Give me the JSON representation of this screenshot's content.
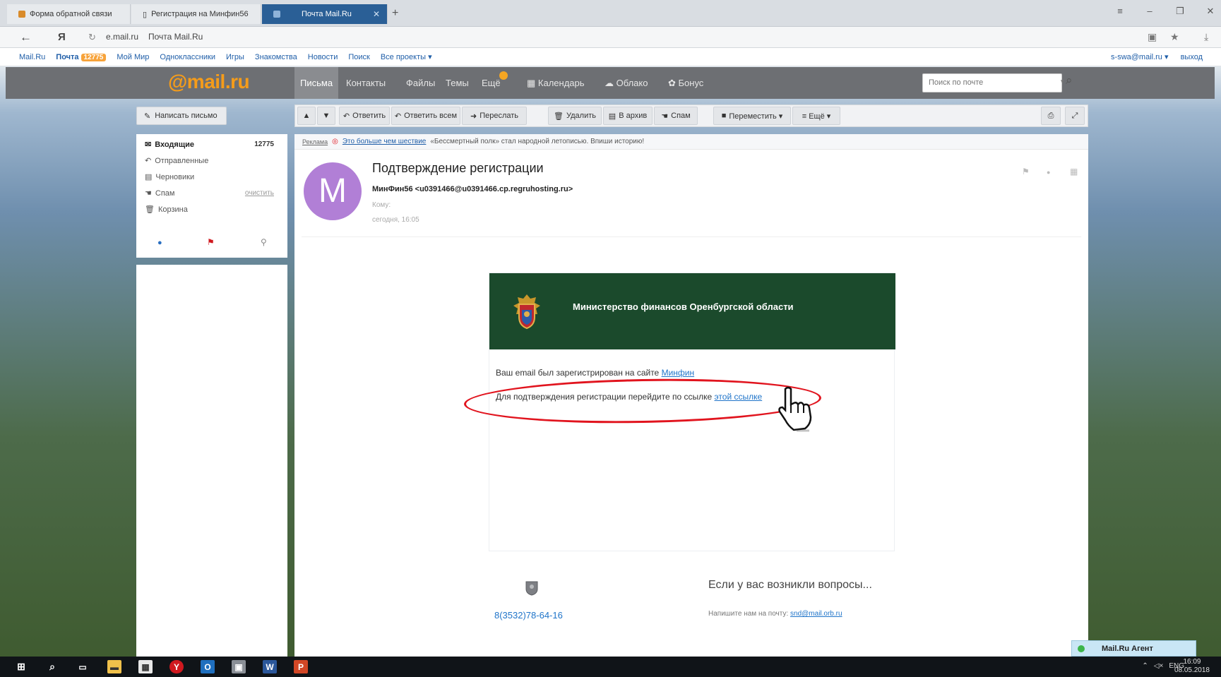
{
  "browser": {
    "tabs": [
      {
        "label": "Форма обратной связи",
        "active": false
      },
      {
        "label": "Регистрация на Минфин56",
        "active": false
      },
      {
        "label": "Почта Mail.Ru",
        "active": true
      }
    ],
    "add_tab": "+",
    "address_host": "e.mail.ru",
    "address_title": "Почта Mail.Ru",
    "window_controls": [
      "≡",
      "–",
      "❐",
      "✕"
    ]
  },
  "portal_bar": {
    "links": [
      {
        "label": "Mail.Ru"
      },
      {
        "label": "Почта",
        "badge": "12775"
      },
      {
        "label": "Мой Мир"
      },
      {
        "label": "Одноклассники"
      },
      {
        "label": "Игры"
      },
      {
        "label": "Знакомства"
      },
      {
        "label": "Новости"
      },
      {
        "label": "Поиск"
      },
      {
        "label": "Все проекты ▾"
      }
    ],
    "user": "s-swa@mail.ru ▾",
    "logout": "выход"
  },
  "header": {
    "logo_at": "@mail",
    "logo_ru": ".ru",
    "nav": [
      "Письма",
      "Контакты",
      "Файлы",
      "Темы",
      "Ещё"
    ],
    "services": [
      "Календарь",
      "Облако",
      "Бонус"
    ],
    "search_placeholder": "Поиск по почте",
    "search_dropdown": "▾"
  },
  "compose_label": "Написать письмо",
  "toolbar": {
    "reply": "Ответить",
    "reply_all": "Ответить всем",
    "forward": "Переслать",
    "delete": "Удалить",
    "archive": "В архив",
    "spam": "Спам",
    "move": "Переместить ▾",
    "more": "≡ Ещё ▾"
  },
  "folders": [
    {
      "label": "Входящие",
      "count": "12775",
      "bold": true
    },
    {
      "label": "Отправленные",
      "count": ""
    },
    {
      "label": "Черновики",
      "count": ""
    },
    {
      "label": "Спам",
      "count": "очистить"
    },
    {
      "label": "Корзина",
      "count": ""
    }
  ],
  "ad": {
    "label": "Реклама",
    "link": "Это больше чем шествие",
    "text": "«Бессмертный полк» стал народной летописью. Впиши историю!"
  },
  "message": {
    "avatar_letter": "M",
    "subject": "Подтверждение регистрации",
    "from": "МинФин56 <u0391466@u0391466.cp.regruhosting.ru>",
    "to_label": "Кому:",
    "date": "сегодня, 16:05"
  },
  "letter": {
    "ministry": "Министерство финансов Оренбургской области",
    "line1_text": "Ваш email был зарегистрирован на сайте",
    "line1_link": "Минфин",
    "line2_text": "Для подтверждения регистрации перейдите по ссылке",
    "line2_link": "этой ссылке"
  },
  "footer": {
    "phone": "8(3532)78-64-16",
    "questions": "Если у вас возникли вопросы...",
    "write_text": "Напишите нам на почту:",
    "email": "snd@mail.orb.ru"
  },
  "agent_label": "Mail.Ru Агент",
  "taskbar": {
    "lang": "ENG",
    "time": "16:09",
    "date": "08.05.2018"
  },
  "colors": {
    "accent_orange": "#f59c1a",
    "header_gray": "#6d6f73",
    "banner_green": "#1b4a2c",
    "annotation_red": "#e1141e",
    "link_blue": "#1f74c9"
  }
}
